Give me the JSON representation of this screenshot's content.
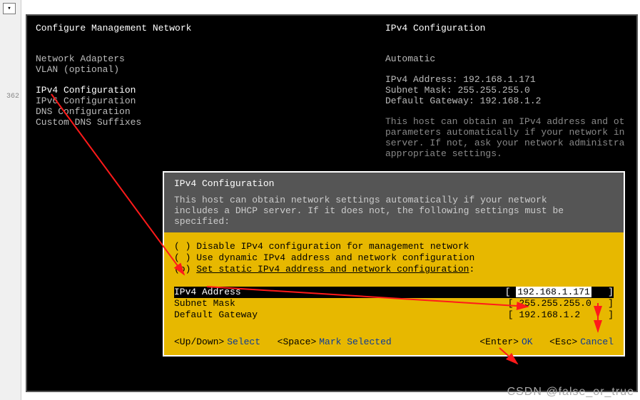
{
  "header": {
    "left_title": "Configure Management Network",
    "right_title": "IPv4 Configuration"
  },
  "menu": {
    "network_adapters": "Network Adapters",
    "vlan": "VLAN (optional)",
    "ipv4": "IPv4 Configuration",
    "ipv6": "IPv6 Configuration",
    "dns": "DNS Configuration",
    "custom_dns": "Custom DNS Suffixes"
  },
  "right_panel": {
    "mode": "Automatic",
    "ipv4_label": "IPv4 Address:",
    "ipv4_value": "192.168.1.171",
    "mask_label": "Subnet Mask:",
    "mask_value": "255.255.255.0",
    "gw_label": "Default Gateway:",
    "gw_value": "192.168.1.2",
    "desc_l1": "This host can obtain an IPv4 address and ot",
    "desc_l2": "parameters automatically if your network in",
    "desc_l3": "server. If not, ask your network administra",
    "desc_l4": "appropriate settings."
  },
  "dialog": {
    "title": "IPv4 Configuration",
    "help_l1": "This host can obtain network settings automatically if your network",
    "help_l2": "includes a DHCP server. If it does not, the following settings must be",
    "help_l3": "specified:",
    "opt_disable": "Disable IPv4 configuration for management network",
    "opt_dynamic": "Use dynamic IPv4 address and network configuration",
    "opt_static": "Set static IPv4 address and network configuration",
    "opt_static_colon": ":",
    "field_ipv4": "IPv4 Address",
    "field_ipv4_val": "192.168.1.171",
    "field_mask": "Subnet Mask",
    "field_mask_val": "255.255.255.0",
    "field_gw": "Default Gateway",
    "field_gw_val": "192.168.1.2",
    "legend_updown": "<Up/Down>",
    "legend_select": "Select",
    "legend_space": "<Space>",
    "legend_mark": "Mark Selected",
    "legend_enter": "<Enter>",
    "legend_ok": "OK",
    "legend_esc": "<Esc>",
    "legend_cancel": "Cancel"
  },
  "gutter": {
    "line": "362"
  },
  "watermark": "CSDN @false_or_true"
}
